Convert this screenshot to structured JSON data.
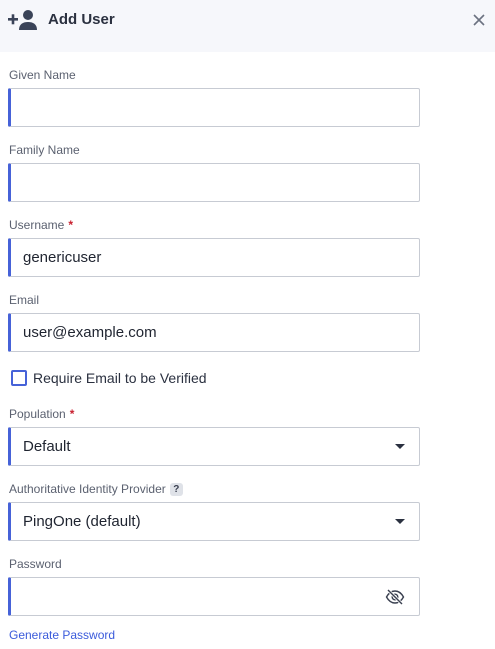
{
  "header": {
    "title": "Add User",
    "icon": "user-add-icon",
    "close_icon": "close-icon"
  },
  "form": {
    "given_name": {
      "label": "Given Name",
      "value": ""
    },
    "family_name": {
      "label": "Family Name",
      "value": ""
    },
    "username": {
      "label": "Username",
      "required_mark": "*",
      "value": "genericuser"
    },
    "email": {
      "label": "Email",
      "value": "user@example.com"
    },
    "require_email_verified": {
      "label": "Require Email to be Verified",
      "checked": false
    },
    "population": {
      "label": "Population",
      "required_mark": "*",
      "value": "Default"
    },
    "identity_provider": {
      "label": "Authoritative Identity Provider",
      "help_icon": "?",
      "value": "PingOne (default)"
    },
    "password": {
      "label": "Password",
      "value": "",
      "toggle_icon": "eye-slash-icon"
    },
    "generate_password_link": "Generate Password"
  },
  "colors": {
    "accent": "#4662d8",
    "link": "#3b5bdb",
    "required": "#c8202f",
    "header_bg": "#f6f7fb"
  }
}
